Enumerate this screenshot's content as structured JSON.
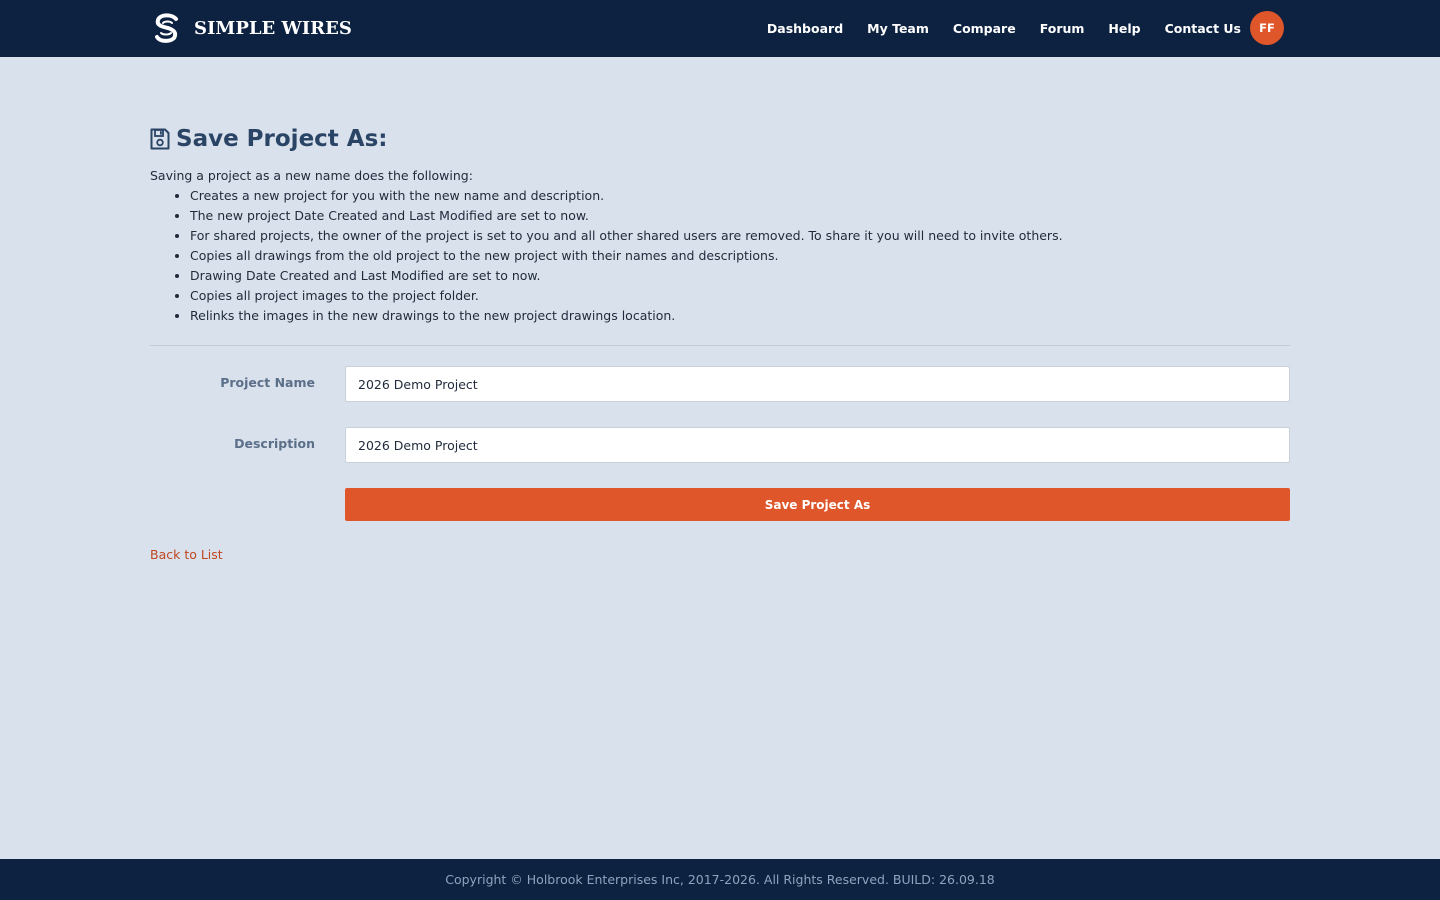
{
  "brand": {
    "name": "SIMPLE WIRES",
    "logo_icon": "simple-wires-logo"
  },
  "nav": {
    "items": [
      {
        "label": "Dashboard"
      },
      {
        "label": "My Team"
      },
      {
        "label": "Compare"
      },
      {
        "label": "Forum"
      },
      {
        "label": "Help"
      },
      {
        "label": "Contact Us"
      }
    ],
    "avatar_initials": "FF"
  },
  "page": {
    "title": "Save Project As:",
    "title_icon": "floppy-disk-icon",
    "intro": "Saving a project as a new name does the following:",
    "list": [
      "Creates a new project for you with the new name and description.",
      "The new project Date Created and Last Modified are set to now.",
      "For shared projects, the owner of the project is set to you and all other shared users are removed. To share it you will need to invite others.",
      "Copies all drawings from the old project to the new project with their names and descriptions.",
      "Drawing Date Created and Last Modified are set to now.",
      "Copies all project images to the project folder.",
      "Relinks the images in the new drawings to the new project drawings location."
    ]
  },
  "form": {
    "project_name_label": "Project Name",
    "project_name_value": "2026 Demo Project",
    "description_label": "Description",
    "description_value": "2026 Demo Project",
    "submit_label": "Save Project As"
  },
  "back_link": "Back to List",
  "footer": {
    "text": "Copyright © Holbrook Enterprises Inc, 2017-2026. All Rights Reserved. BUILD: 26.09.18"
  },
  "colors": {
    "navbar_bg": "#0c2240",
    "page_bg": "#d9e1ec",
    "accent": "#e0562b",
    "title": "#2a4466",
    "link": "#c0471f"
  }
}
